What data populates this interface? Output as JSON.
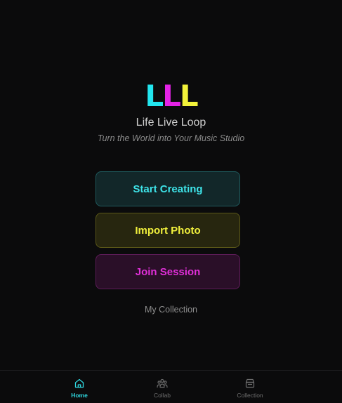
{
  "logo": {
    "letters": [
      "L",
      "L",
      "L"
    ],
    "colors": [
      "#22e6ef",
      "#e423e6",
      "#f2f23a"
    ]
  },
  "app_name": "Life Live Loop",
  "tagline": "Turn the World into Your Music Studio",
  "actions": [
    {
      "label": "Start Creating",
      "text_color": "#3ee3e8",
      "bg": "#122729",
      "border": "#1f5a5d"
    },
    {
      "label": "Import Photo",
      "text_color": "#f0ef3c",
      "bg": "#27260f",
      "border": "#5a5718"
    },
    {
      "label": "Join Session",
      "text_color": "#e02fd8",
      "bg": "#2a0f28",
      "border": "#5d1c58"
    }
  ],
  "secondary_link": "My Collection",
  "tabs": [
    {
      "label": "Home",
      "icon": "home-icon",
      "active": true
    },
    {
      "label": "Collab",
      "icon": "users-icon",
      "active": false
    },
    {
      "label": "Collection",
      "icon": "archive-icon",
      "active": false
    }
  ],
  "colors": {
    "background": "#0b0b0c",
    "tab_active": "#2fd8e0",
    "tab_inactive": "#6e6e6e"
  }
}
